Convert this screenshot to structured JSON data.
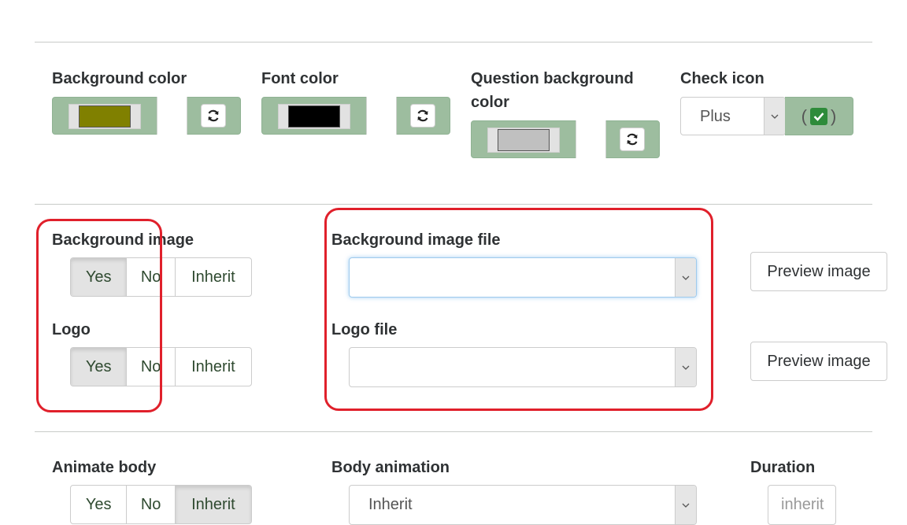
{
  "row1": {
    "bg_color": {
      "label": "Background color",
      "swatch": "#808000"
    },
    "font_color": {
      "label": "Font color",
      "swatch": "#000000"
    },
    "question_bg": {
      "label_line1": "Question background",
      "label_line2": "color",
      "swatch": "#c0c0c0"
    },
    "check_icon": {
      "label": "Check icon",
      "selected": "Plus",
      "preview_open": "(",
      "preview_close": ")"
    }
  },
  "row2": {
    "bg_image": {
      "label": "Background image",
      "options": [
        "Yes",
        "No",
        "Inherit"
      ],
      "active": "Yes"
    },
    "logo": {
      "label": "Logo",
      "options": [
        "Yes",
        "No",
        "Inherit"
      ],
      "active": "Yes"
    },
    "bg_image_file": {
      "label": "Background image file",
      "value": ""
    },
    "logo_file": {
      "label": "Logo file",
      "value": ""
    },
    "preview1": "Preview image",
    "preview2": "Preview image"
  },
  "row3": {
    "animate_body": {
      "label": "Animate body",
      "options": [
        "Yes",
        "No",
        "Inherit"
      ],
      "active": "Inherit"
    },
    "body_animation": {
      "label": "Body animation",
      "selected": "Inherit"
    },
    "duration": {
      "label": "Duration",
      "value": "inherit"
    }
  },
  "colors": {
    "accent_green": "#9dbd9f",
    "highlight_red": "#e0202b"
  }
}
